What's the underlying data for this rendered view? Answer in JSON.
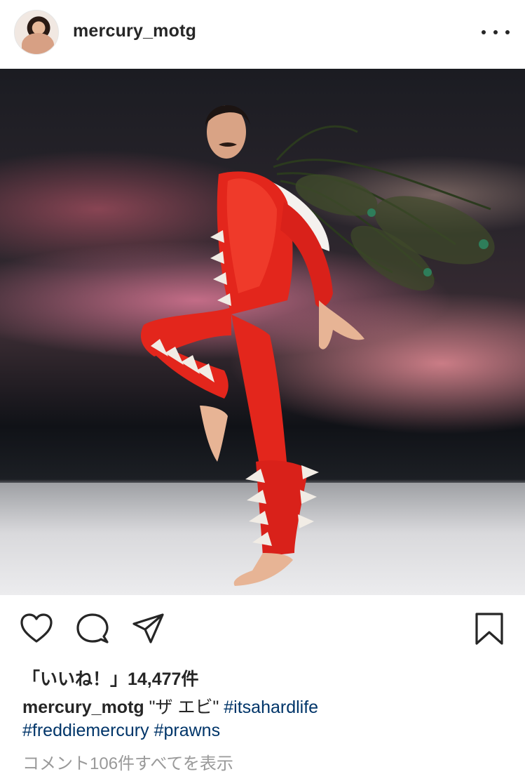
{
  "post": {
    "username": "mercury_motg",
    "more_icon": "more-horizontal-icon",
    "photo_alt": "",
    "likes_label": "「いいね！」14,477件",
    "caption_user": "mercury_motg",
    "caption_text": " \"ザ エビ\" ",
    "hashtags": [
      "#itsahardlife",
      "#freddiemercury",
      "#prawns"
    ],
    "comments_link": "コメント106件すべてを表示"
  },
  "actions": {
    "like_icon": "heart-icon",
    "comment_icon": "comment-icon",
    "share_icon": "send-icon",
    "save_icon": "bookmark-icon"
  },
  "colors": {
    "text": "#262626",
    "hashtag": "#003569",
    "muted": "#999999",
    "suit_red": "#e3261c"
  }
}
